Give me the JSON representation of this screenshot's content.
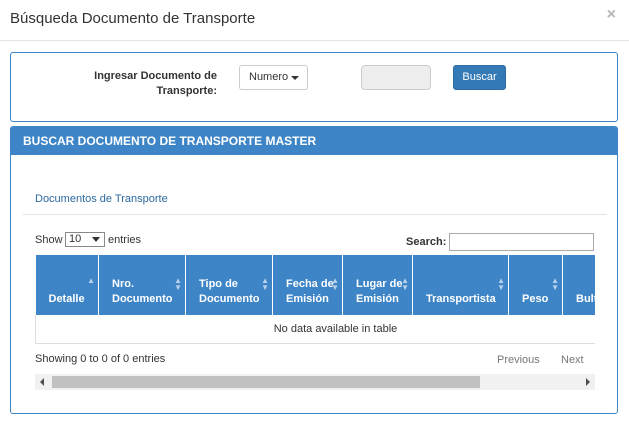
{
  "modal": {
    "title": "Búsqueda Documento de Transporte",
    "close_glyph": "×"
  },
  "search": {
    "label": "Ingresar Documento de Transporte:",
    "type_selected": "Numero",
    "doc_value": "",
    "button_label": "Buscar"
  },
  "master": {
    "heading": "BUSCAR DOCUMENTO DE TRANSPORTE MASTER",
    "section_title": "Documentos de Transporte",
    "length": {
      "show_label": "Show",
      "selected": "10",
      "entries_label": "entries"
    },
    "filter_label": "Search:",
    "columns": [
      "Detalle",
      "Nro. Documento",
      "Tipo de Documento",
      "Fecha de Emisión",
      "Lugar de Emisión",
      "Transportista",
      "Peso",
      "Bultos"
    ],
    "empty_message": "No data available in table",
    "info": "Showing 0 to 0 of 0 entries",
    "pagination": {
      "previous": "Previous",
      "next": "Next"
    }
  },
  "colors": {
    "accent": "#3d85c6",
    "button": "#337ab7"
  }
}
